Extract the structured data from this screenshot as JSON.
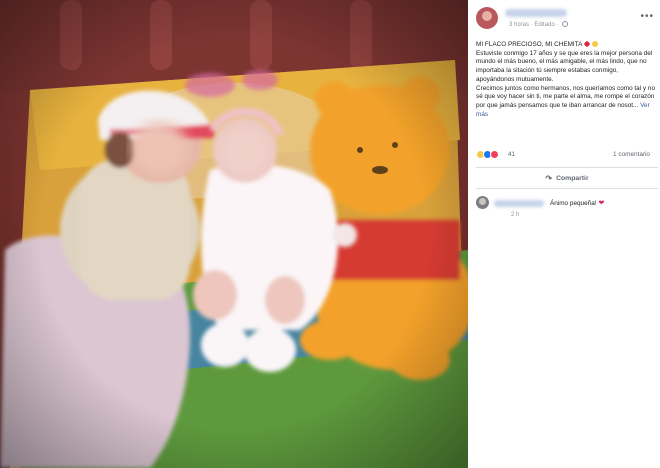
{
  "post": {
    "timestamp": "3 horas",
    "edited_label": "Editado",
    "options_icon": "more-dots-icon",
    "text_lines": [
      "MI FLACO PRECIOSO, MI CHEMITA",
      "Estuviste conmigo 17 años y se que eres la mejor persona del mundo el más bueno, el más amigable, el más lindo, que no importaba la sitación tú siempre estabas conmigo, apoyándonos mutuamente.",
      "Crecimos juntos como hermanos, nos queríamos como tal y no sé que voy hacer sin ti, me parte el alma, me rompe el corazón por que jamás pensamos que te iban arrancar de nosot..."
    ],
    "see_more": "Ver más",
    "reaction_count": "41",
    "comment_count": "1 comentario",
    "share_label": "Compartir",
    "colors": {
      "link": "#385898",
      "text": "#1c1e21",
      "meta": "#90949c"
    }
  },
  "comments": [
    {
      "text": "Ánimo pequeña!",
      "time": "2 h"
    }
  ]
}
